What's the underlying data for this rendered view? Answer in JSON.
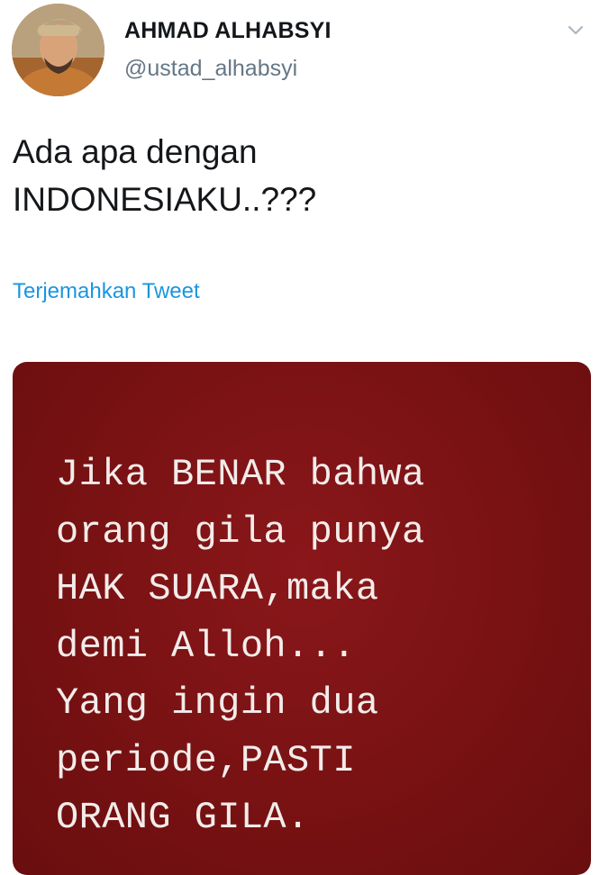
{
  "tweet": {
    "author": {
      "display_name": "AHMAD ALHABSYI",
      "handle": "@ustad_alhabsyi",
      "avatar_icon": "profile-photo"
    },
    "menu_icon": "chevron-down-icon",
    "text_lines": [
      "Ada apa dengan",
      "INDONESIAKU..???"
    ],
    "translate_label": "Terjemahkan Tweet",
    "colors": {
      "link": "#1b95e0",
      "handle": "#657786",
      "card_background": "#7a1214",
      "card_text": "#f2ecea"
    }
  },
  "media": {
    "text_lines": [
      "Jika BENAR bahwa",
      "orang gila punya",
      "HAK SUARA,maka",
      "demi Alloh...",
      "Yang ingin dua",
      "periode,PASTI",
      "ORANG GILA."
    ]
  }
}
